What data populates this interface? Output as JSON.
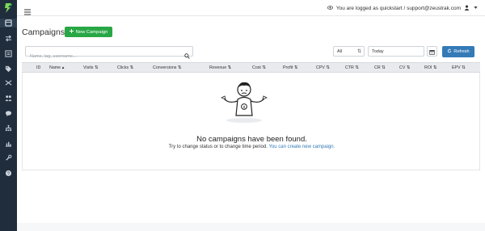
{
  "topbar": {
    "logged_in_text": "You are logged as quickstart / support@zeustrak.com"
  },
  "sidebar": {
    "items": [
      {
        "icon": "dashboard-icon"
      },
      {
        "icon": "exchange-icon"
      },
      {
        "icon": "campaigns-icon"
      },
      {
        "icon": "tag-icon"
      },
      {
        "icon": "shuffle-icon"
      },
      {
        "icon": "users-icon"
      },
      {
        "icon": "chat-icon"
      },
      {
        "icon": "sitemap-icon"
      },
      {
        "icon": "reports-icon"
      },
      {
        "icon": "tools-icon"
      },
      {
        "icon": "help-icon"
      }
    ]
  },
  "page": {
    "title": "Campaigns",
    "new_button": "New Campaign"
  },
  "filters": {
    "search_placeholder": "Name, tag, username...",
    "status_value": "All",
    "date_value": "Today",
    "refresh_label": "Refresh"
  },
  "table": {
    "columns": [
      "ID",
      "Name",
      "Visits",
      "Clicks",
      "Conversions",
      "Revenue",
      "Cost",
      "Profit",
      "CPV",
      "CTR",
      "CR",
      "CV",
      "ROI",
      "EPV"
    ]
  },
  "empty_state": {
    "title": "No campaigns have been found.",
    "subtitle": "Try to change status or to change time period.",
    "link_text": "You can create new campaign."
  },
  "colors": {
    "sidebar": "#1f2d3d",
    "new_button": "#28a745",
    "refresh_button": "#337ab7",
    "link": "#337ab7"
  }
}
